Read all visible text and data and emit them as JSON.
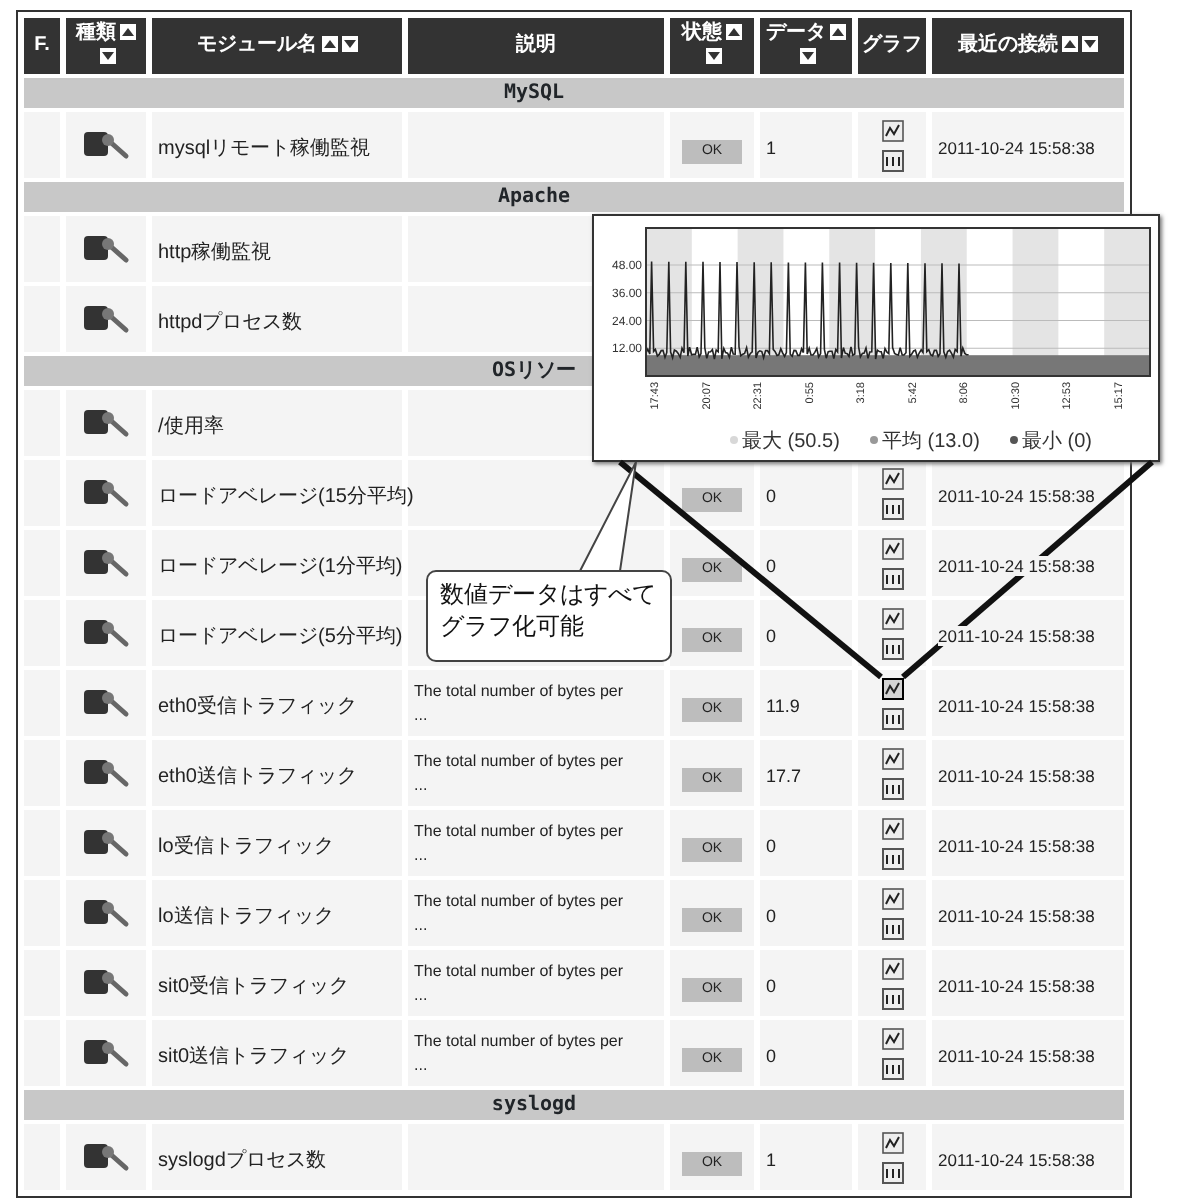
{
  "table": {
    "columns": [
      {
        "label": "F.",
        "sortable": false
      },
      {
        "label": "種類",
        "sortable": true
      },
      {
        "label": "モジュール名",
        "sortable": true
      },
      {
        "label": "説明",
        "sortable": false
      },
      {
        "label": "状態",
        "sortable": true
      },
      {
        "label": "データ",
        "sortable": true
      },
      {
        "label": "グラフ",
        "sortable": false
      },
      {
        "label": "最近の接続",
        "sortable": true
      }
    ],
    "groups": [
      {
        "label": "MySQL",
        "rows": [
          {
            "name": "mysqlリモート稼働監視",
            "status": "OK",
            "data": "1",
            "graph_zoomed": false,
            "last_contact": "2011-10-24 15:58:38"
          }
        ]
      },
      {
        "label": "Apache",
        "rows": [
          {
            "name": "http稼働監視"
          },
          {
            "name": "httpdプロセス数"
          }
        ]
      },
      {
        "label": "OSリソー",
        "rows": [
          {
            "name": "/使用率"
          },
          {
            "name": "ロードアベレージ(15分平均)",
            "status": "OK",
            "data": "0",
            "graph_zoomed": false,
            "last_contact": "2011-10-24 15:58:38"
          },
          {
            "name": "ロードアベレージ(1分平均)",
            "status": "OK",
            "data": "0",
            "graph_zoomed": false,
            "last_contact": "2011-10-24 15:58:38"
          },
          {
            "name": "ロードアベレージ(5分平均)",
            "status": "OK",
            "data": "0",
            "graph_zoomed": false,
            "last_contact": "2011-10-24 15:58:38"
          },
          {
            "name": "eth0受信トラフィック",
            "description": "The total number of bytes per\n...",
            "status": "OK",
            "data": "11.9",
            "graph_zoomed": true,
            "last_contact": "2011-10-24 15:58:38"
          },
          {
            "name": "eth0送信トラフィック",
            "description": "The total number of bytes per\n...",
            "status": "OK",
            "data": "17.7",
            "graph_zoomed": false,
            "last_contact": "2011-10-24 15:58:38"
          },
          {
            "name": "lo受信トラフィック",
            "description": "The total number of bytes per\n...",
            "status": "OK",
            "data": "0",
            "graph_zoomed": false,
            "last_contact": "2011-10-24 15:58:38"
          },
          {
            "name": "lo送信トラフィック",
            "description": "The total number of bytes per\n...",
            "status": "OK",
            "data": "0",
            "graph_zoomed": false,
            "last_contact": "2011-10-24 15:58:38"
          },
          {
            "name": "sit0受信トラフィック",
            "description": "The total number of bytes per\n...",
            "status": "OK",
            "data": "0",
            "graph_zoomed": false,
            "last_contact": "2011-10-24 15:58:38"
          },
          {
            "name": "sit0送信トラフィック",
            "description": "The total number of bytes per\n...",
            "status": "OK",
            "data": "0",
            "graph_zoomed": false,
            "last_contact": "2011-10-24 15:58:38"
          }
        ]
      },
      {
        "label": "syslogd",
        "rows": [
          {
            "name": "syslogdプロセス数",
            "status": "OK",
            "data": "1",
            "graph_zoomed": false,
            "last_contact": "2011-10-24 15:58:38"
          }
        ]
      }
    ]
  },
  "chart_popup": {
    "yticks": [
      "48.00",
      "36.00",
      "24.00",
      "12.00"
    ],
    "xticks": [
      "17:43",
      "20:07",
      "22:31",
      "0:55",
      "3:18",
      "5:42",
      "8:06",
      "10:30",
      "12:53",
      "15:17"
    ],
    "legend": [
      {
        "label": "最大 (50.5)",
        "color": "#d8d8d8"
      },
      {
        "label": "平均 (13.0)",
        "color": "#999999"
      },
      {
        "label": "最小 (0)",
        "color": "#555555"
      }
    ]
  },
  "callout": {
    "text": "数値データはすべてグラフ化可能"
  }
}
